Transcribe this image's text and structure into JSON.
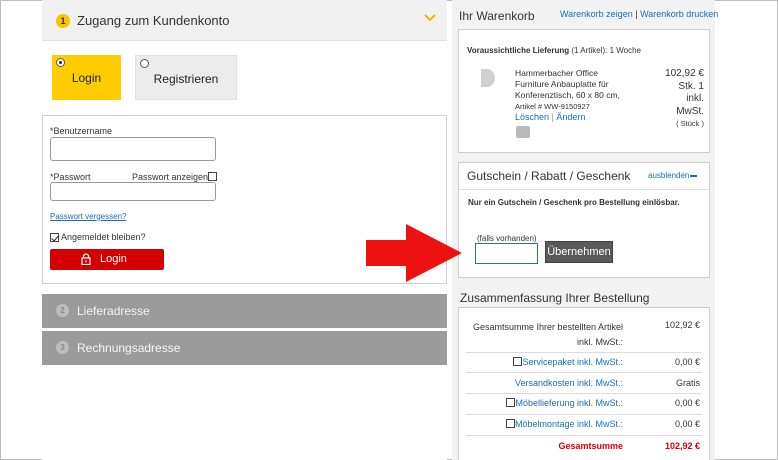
{
  "login_section": {
    "step_number": "1",
    "title": "Zugang zum Kundenkonto",
    "tab_login": "Login",
    "tab_register": "Registrieren",
    "username_label": "*Benutzername",
    "password_label": "*Passwort",
    "show_password": "Passwort anzeigen",
    "forgot_password": "Passwort vergessen?",
    "stay_logged_in": "Angemeldet bleiben?",
    "login_button": "Login"
  },
  "steps": [
    {
      "number": "2",
      "label": "Lieferadresse"
    },
    {
      "number": "3",
      "label": "Rechnungsadresse"
    }
  ],
  "cart": {
    "title": "Ihr Warenkorb",
    "show_link": "Warenkorb zeigen",
    "print_link": "Warenkorb drucken",
    "delivery_label": "Voraussichtliche Lieferung",
    "delivery_count": "(1 Artikel): 1 Woche",
    "product": {
      "name_line1": "Hammerbacher Office",
      "name_line2": "Furniture Anbauplatte für",
      "name_line3": "Konferenztisch, 60 x 80 cm,",
      "article": "Artikel # WW-9150927",
      "price": "102,92 €",
      "qty_line1": "Stk. 1",
      "qty_line2": "inkl.",
      "qty_line3": "MwSt.",
      "unit": "( Stück )",
      "delete": "Löschen",
      "change": "Ändern"
    }
  },
  "voucher": {
    "title": "Gutschein / Rabatt / Geschenk",
    "hide": "ausblenden",
    "note": "Nur ein Gutschein / Geschenk pro Bestellung einlösbar.",
    "if_available": "(falls vorhanden)",
    "apply": "Übernehmen"
  },
  "summary": {
    "title": "Zusammenfassung Ihrer Bestellung",
    "total_items_line1": "Gesamtsumme Ihrer bestellten Artikel",
    "total_items_line2": "inkl. MwSt.:",
    "total_items_value": "102,92 €",
    "service_label": "Servicepaket inkl. MwSt.:",
    "service_value": "0,00 €",
    "shipping_label": "Versandkosten inkl. MwSt.:",
    "shipping_value": "Gratis",
    "furniture_delivery_label": "Möbellieferung inkl. MwSt.:",
    "furniture_delivery_value": "0,00 €",
    "assembly_label": "Möbelmontage inkl. MwSt.:",
    "assembly_value": "0,00 €",
    "grand_total_label": "Gesamtsumme",
    "grand_total_value": "102,92 €"
  },
  "colors": {
    "accent_yellow": "#fecc00",
    "login_red": "#d40000",
    "link_blue": "#1a6db5",
    "total_red": "#e00000"
  }
}
